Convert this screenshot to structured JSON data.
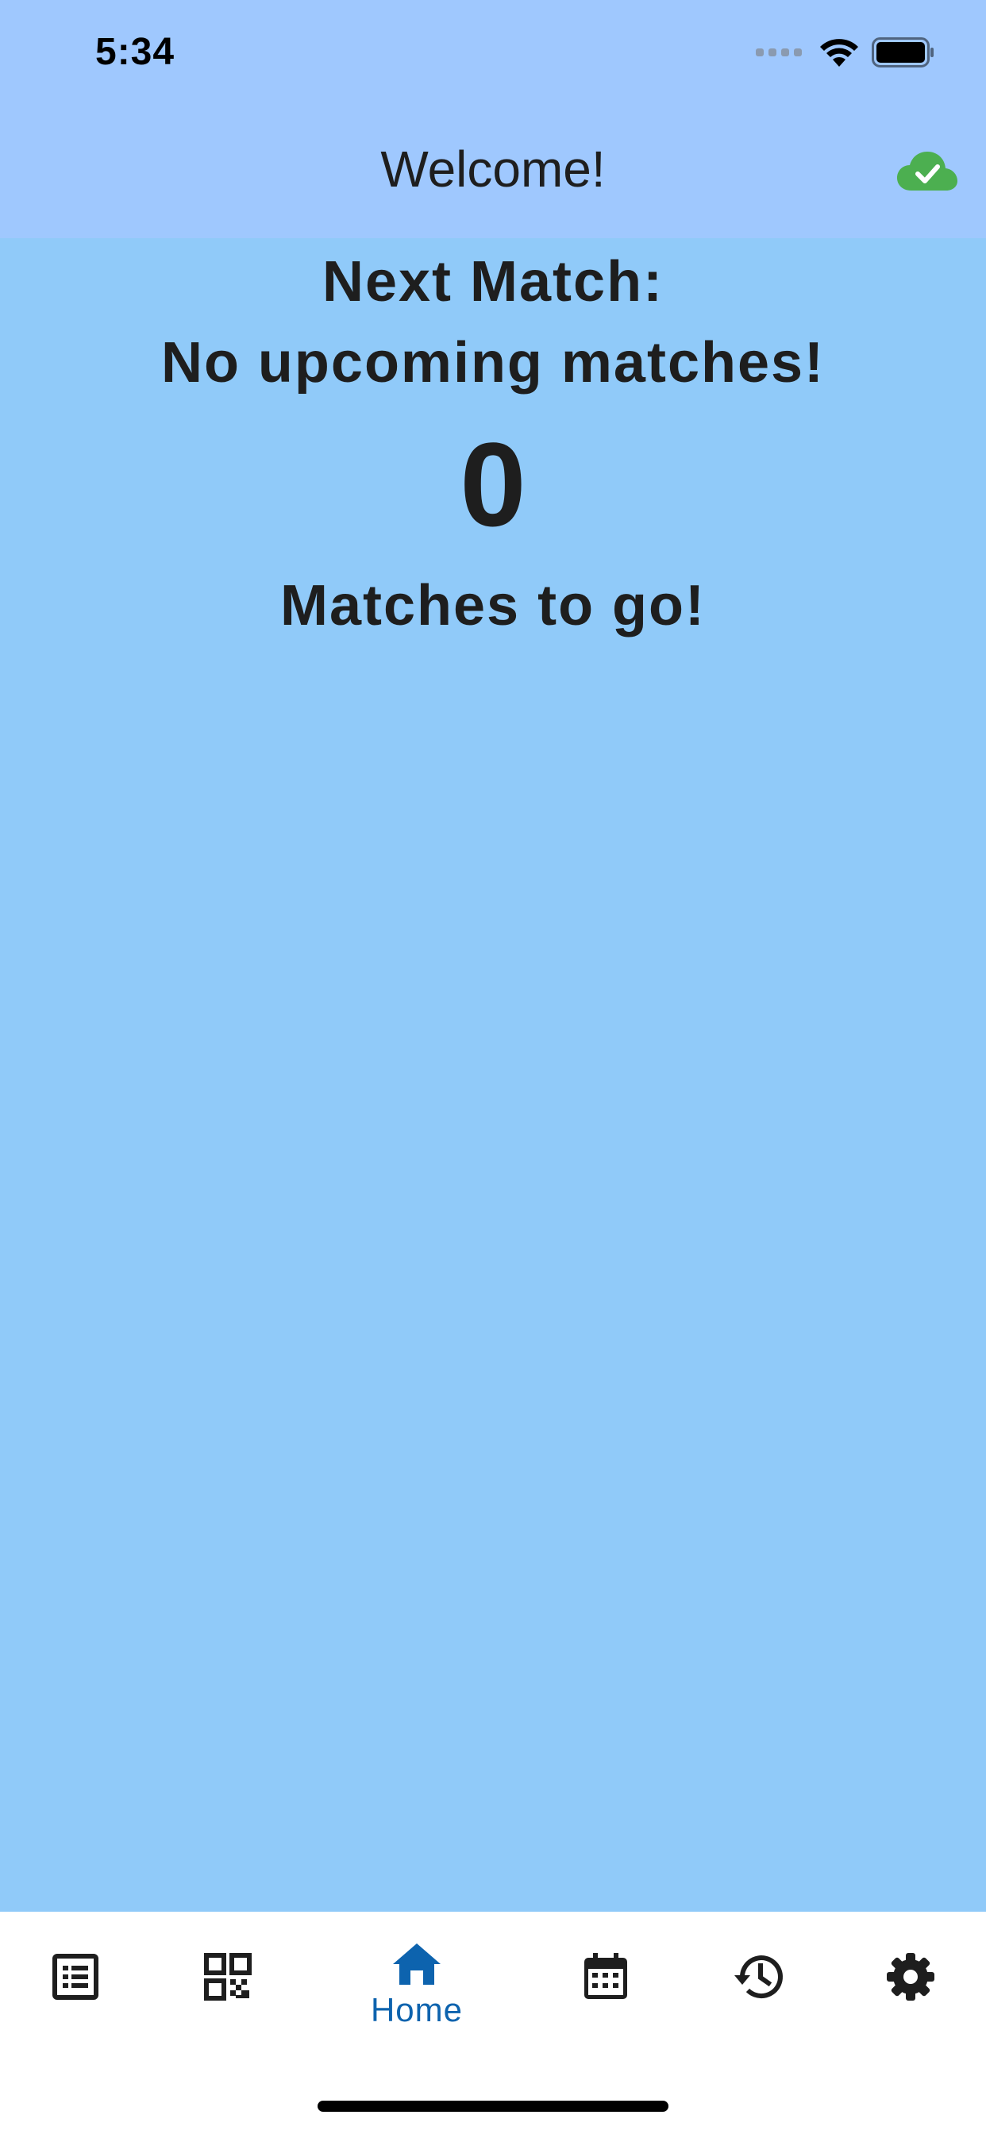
{
  "status_bar": {
    "time": "5:34"
  },
  "app_bar": {
    "title": "Welcome!",
    "sync_icon": "cloud-done-icon",
    "sync_color": "#4CAF50"
  },
  "home": {
    "next_match_label": "Next Match:",
    "next_match_value": "No upcoming matches!",
    "matches_count": "0",
    "matches_label": "Matches to go!"
  },
  "bottom_nav": {
    "items": [
      {
        "icon": "list-icon",
        "label": ""
      },
      {
        "icon": "qr-code-icon",
        "label": ""
      },
      {
        "icon": "home-icon",
        "label": "Home",
        "selected": true
      },
      {
        "icon": "calendar-icon",
        "label": ""
      },
      {
        "icon": "history-icon",
        "label": ""
      },
      {
        "icon": "settings-icon",
        "label": ""
      }
    ],
    "active_color": "#0D63AE"
  },
  "colors": {
    "app_bar_bg": "#9FC8FE",
    "content_bg": "#90CAF9",
    "nav_bg": "#FFFFFF"
  }
}
